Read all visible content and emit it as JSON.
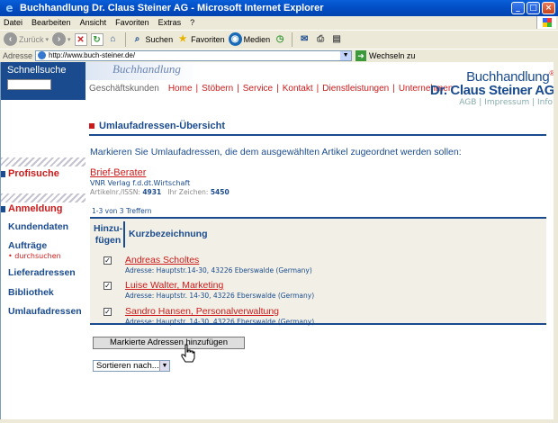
{
  "window": {
    "title": "Buchhandlung Dr. Claus Steiner AG - Microsoft Internet Explorer",
    "buttons": {
      "minimize": "_",
      "maximize": "□",
      "close": "×"
    }
  },
  "menu": [
    "Datei",
    "Bearbeiten",
    "Ansicht",
    "Favoriten",
    "Extras",
    "?"
  ],
  "toolbar": {
    "back": "Zurück",
    "search": "Suchen",
    "favorites": "Favoriten",
    "media": "Medien"
  },
  "address": {
    "label": "Adresse",
    "url": "http://www.buch-steiner.de/",
    "go": "Wechseln zu"
  },
  "sidebar": {
    "quicksearch": "Schnellsuche",
    "profisuche": "Profisuche",
    "anmeldung": "Anmeldung",
    "nav": [
      "Kundendaten",
      "Aufträge",
      "Lieferadressen",
      "Bibliothek",
      "Umlaufadressen"
    ],
    "sub_auftraege": "• durchsuchen"
  },
  "header": {
    "banner": "Buchhandlung",
    "gk": "Geschäftskunden",
    "nav": [
      "Home",
      "Stöbern",
      "Service",
      "Kontakt",
      "Dienstleistungen",
      "Unternehmen"
    ],
    "brand_line1": "Buchhandlung",
    "brand_line2": "Dr. Claus Steiner AG",
    "brand_reg": "®",
    "meta": "AGB | Impressum | Info"
  },
  "main": {
    "title": "Umlaufadressen-Übersicht",
    "intro": "Markieren Sie Umlaufadressen, die dem ausgewählten Artikel zugeordnet werden sollen:",
    "product": {
      "title": "Brief-Berater",
      "publisher": "VNR Verlag f.d.dt.Wirtschaft",
      "articleno_label": "Artikelnr./ISSN:",
      "articleno": "4931",
      "ref_label": "Ihr Zeichen:",
      "ref": "5450"
    },
    "hits": "1-3 von 3 Treffern",
    "table": {
      "col_add": "Hinzu-fügen",
      "col_add_l1": "Hinzu-",
      "col_add_l2": "fügen",
      "col_name": "Kurzbezeichnung",
      "addr_label": "Adresse:",
      "rows": [
        {
          "name": "Andreas Scholtes",
          "address": "Hauptstr.14-30, 43226 Eberswalde (Germany)",
          "checked": true
        },
        {
          "name": "Luise Walter, Marketing",
          "address": "Hauptstr. 14-30, 43226 Eberswalde (Germany)",
          "checked": true
        },
        {
          "name": "Sandro Hansen, Personalverwaltung",
          "address": "Hauptstr. 14-30, 43226 Eberswalde (Germany)",
          "checked": true
        }
      ]
    },
    "submit": "Markierte Adressen hinzufügen",
    "sort": "Sortieren nach..."
  }
}
